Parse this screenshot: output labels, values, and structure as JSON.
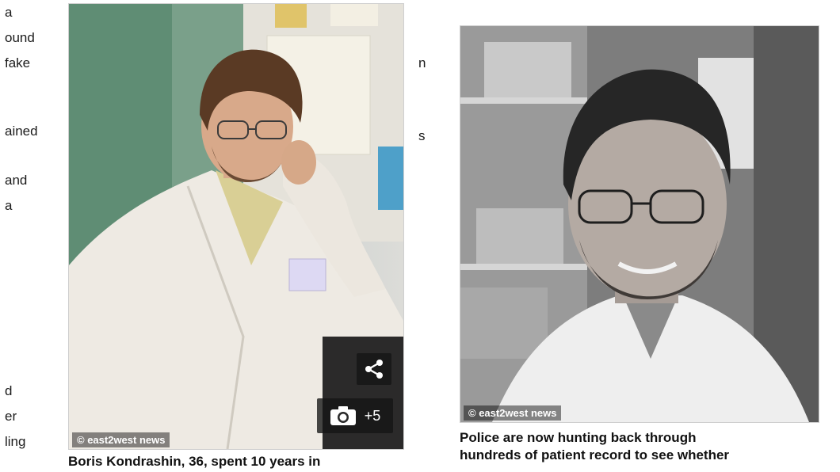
{
  "left_column": {
    "fragments": [
      "a",
      "ound",
      "fake",
      "ained",
      "and",
      "a",
      "d",
      "er",
      "ling"
    ]
  },
  "middle_column": {
    "fragments": [
      "n",
      "s"
    ]
  },
  "photo_1": {
    "watermark": "© east2west news",
    "caption": "Boris Kondrashin, 36, spent 10 years in",
    "gallery_count": "+5"
  },
  "photo_2": {
    "watermark": "© east2west news",
    "caption_line_1": "Police are now hunting back through",
    "caption_line_2": "hundreds of patient record to see whether"
  },
  "icons": {
    "share": "share-icon",
    "camera": "camera-icon"
  }
}
